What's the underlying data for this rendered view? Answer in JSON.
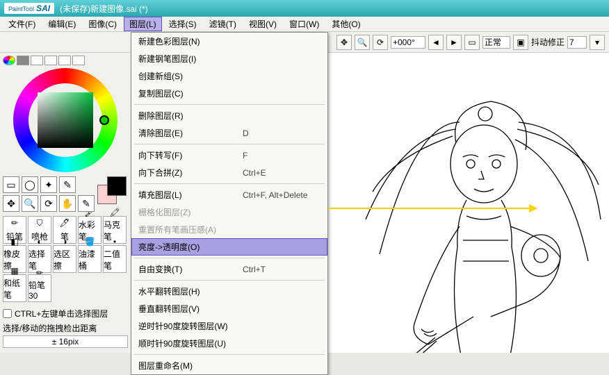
{
  "title": {
    "logo_main": "PaintTool",
    "logo_sub": "SAI",
    "text": "(未保存)新建图像.sai (*)"
  },
  "menubar": [
    "文件(F)",
    "编辑(E)",
    "图像(C)",
    "图层(L)",
    "选择(S)",
    "滤镜(T)",
    "视图(V)",
    "窗口(W)",
    "其他(O)"
  ],
  "toolbar": {
    "angle": "+000°",
    "mode": "正常",
    "stabilizer_label": "抖动修正",
    "stabilizer_value": "7"
  },
  "dropdown": [
    {
      "label": "新建色彩图层(N)"
    },
    {
      "label": "新建钢笔图层(I)"
    },
    {
      "label": "创建新组(S)"
    },
    {
      "label": "复制图层(C)"
    },
    {
      "sep": true
    },
    {
      "label": "删除图层(R)"
    },
    {
      "label": "清除图层(E)",
      "shortcut": "D"
    },
    {
      "sep": true
    },
    {
      "label": "向下转写(F)",
      "shortcut": "F"
    },
    {
      "label": "向下合拼(Z)",
      "shortcut": "Ctrl+E"
    },
    {
      "sep": true
    },
    {
      "label": "填充图层(L)",
      "shortcut": "Ctrl+F, Alt+Delete"
    },
    {
      "label": "栅格化图层(Z)",
      "disabled": true
    },
    {
      "label": "重置所有笔画压感(A)",
      "disabled": true
    },
    {
      "label": "亮度->透明度(O)",
      "highlighted": true
    },
    {
      "sep": true
    },
    {
      "label": "自由变换(T)",
      "shortcut": "Ctrl+T"
    },
    {
      "sep": true
    },
    {
      "label": "水平翻转图层(H)"
    },
    {
      "label": "垂直翻转图层(V)"
    },
    {
      "label": "逆时针90度旋转图层(W)"
    },
    {
      "label": "顺时针90度旋转图层(U)"
    },
    {
      "sep": true
    },
    {
      "label": "图层重命名(M)"
    }
  ],
  "brushes": [
    "铅笔",
    "喷枪",
    "笔",
    "水彩笔",
    "马克笔",
    "橡皮擦",
    "选择笔",
    "选区擦",
    "油漆桶",
    "二值笔",
    "和纸笔",
    "铅笔30"
  ],
  "left": {
    "ctrl_click_label": "CTRL+左键单击选择图层",
    "move_label": "选择/移动的拖拽检出距离",
    "move_value": "± 16pix"
  }
}
